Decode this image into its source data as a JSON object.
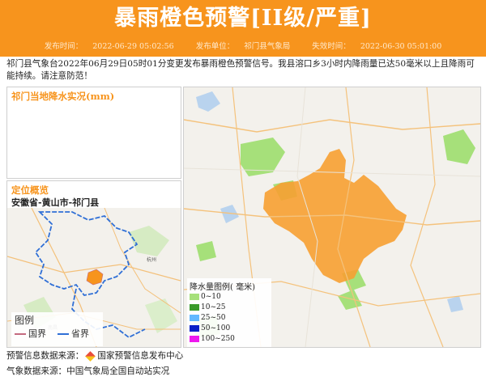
{
  "header": {
    "title": "暴雨橙色预警[II级/严重]",
    "publish_time_label": "发布时间：",
    "publish_time": "2022-06-29 05:02:56",
    "issuer_label": "发布单位：",
    "issuer": "祁门县气象局",
    "expire_label": "失效时间：",
    "expire_time": "2022-06-30 05:01:00"
  },
  "body_text": "祁门县气象台2022年06月29日05时01分变更发布暴雨橙色预警信号。我县溶口乡3小时内降雨量已达50毫米以上且降雨可能持续。请注意防范！",
  "realtime_panel": {
    "title": "祁门当地降水实况(mm)"
  },
  "location_panel": {
    "title": "定位概览",
    "location": "安徽省-黄山市-祁门县",
    "mini_map_labels": [
      "杭州",
      "南昌"
    ],
    "legend": {
      "title": "图例",
      "items": [
        {
          "label": "国界",
          "color": "#c46a7e"
        },
        {
          "label": "省界",
          "color": "#2f6fd6"
        }
      ]
    }
  },
  "rain_legend": {
    "title": "降水量图例( 毫米)",
    "items": [
      {
        "label": "0~10",
        "color": "#a6e07a"
      },
      {
        "label": "10~25",
        "color": "#3a9a2a"
      },
      {
        "label": "25~50",
        "color": "#62b8ff"
      },
      {
        "label": "50~100",
        "color": "#0a1fc8"
      },
      {
        "label": "100~250",
        "color": "#ee18ee"
      }
    ]
  },
  "footer": {
    "warning_source_label": "预警信息数据来源：",
    "warning_source": "国家预警信息发布中心",
    "weather_source_label": "气象数据来源：",
    "weather_source": "中国气象局全国自动站实况"
  },
  "colors": {
    "accent": "#f7941d",
    "warning_area": "#f7a032",
    "light_rain": "#a6e07a"
  }
}
